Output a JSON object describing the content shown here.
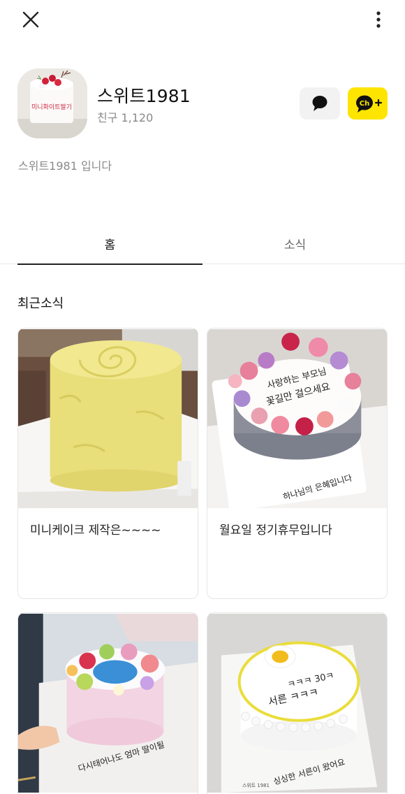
{
  "header": {
    "close_icon": "close-icon",
    "more_icon": "more-vertical-icon"
  },
  "profile": {
    "name": "스위트1981",
    "friends_label": "친구",
    "friends_count": "1,120",
    "avatar_caption": "미니화이트딸기",
    "chat_icon": "chat-bubble-icon",
    "add_channel_icon": "ch-plus-icon",
    "add_channel_text": "Ch",
    "description": "스위트1981 입니다"
  },
  "tabs": [
    {
      "label": "홈",
      "active": true
    },
    {
      "label": "소식",
      "active": false
    }
  ],
  "recent": {
    "title": "최근소식",
    "posts": [
      {
        "title": "미니케이크 제작은~~~~"
      },
      {
        "title": "월요일 정기휴무입니다"
      },
      {
        "title": ""
      },
      {
        "title": ""
      }
    ],
    "cake_texts": {
      "post2_line1": "사랑하는 부모님",
      "post2_line2": "꽃길만 걸으세요",
      "post2_board": "하나님의 은혜입니다",
      "post3_board": "다시태어나도 엄마 딸이될",
      "post4_top": "ㅋㅋㅋ 30ㅋ",
      "post4_mid": "서른 ㅋㅋㅋ",
      "post4_board": "싱싱한 서른이 왔어요",
      "post4_brand": "스위트 1981"
    }
  },
  "colors": {
    "accent_yellow": "#fee500",
    "chat_button_bg": "#f2f2f2",
    "muted_text": "#8a8a8a"
  }
}
